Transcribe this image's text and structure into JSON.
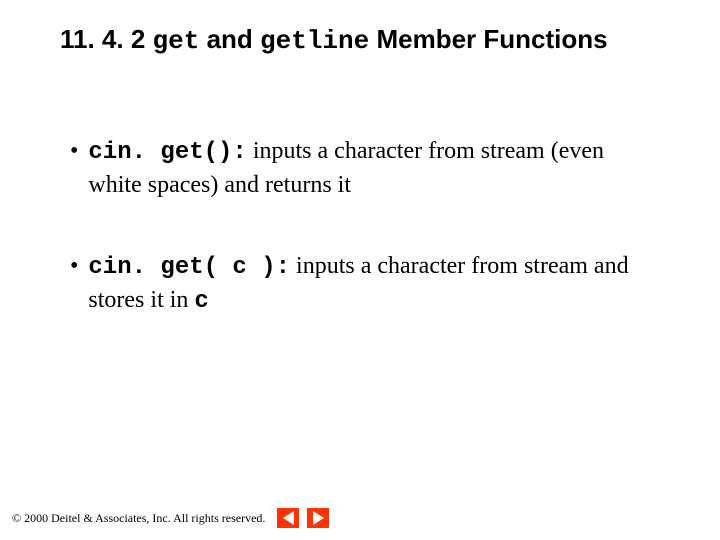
{
  "title": {
    "prefix": "11. 4. 2 ",
    "code1": "get",
    "mid": " and ",
    "code2": "getline",
    "suffix": " Member Functions"
  },
  "bullets": [
    {
      "code": "cin. get():",
      "rest": " inputs a character from stream (even white spaces) and returns it"
    },
    {
      "code": "cin. get( c ):",
      "rest_before": " inputs a character from stream and stores it in ",
      "code_tail": "c"
    }
  ],
  "footer": {
    "copyright": "© 2000 Deitel & Associates, Inc.  All rights reserved."
  }
}
